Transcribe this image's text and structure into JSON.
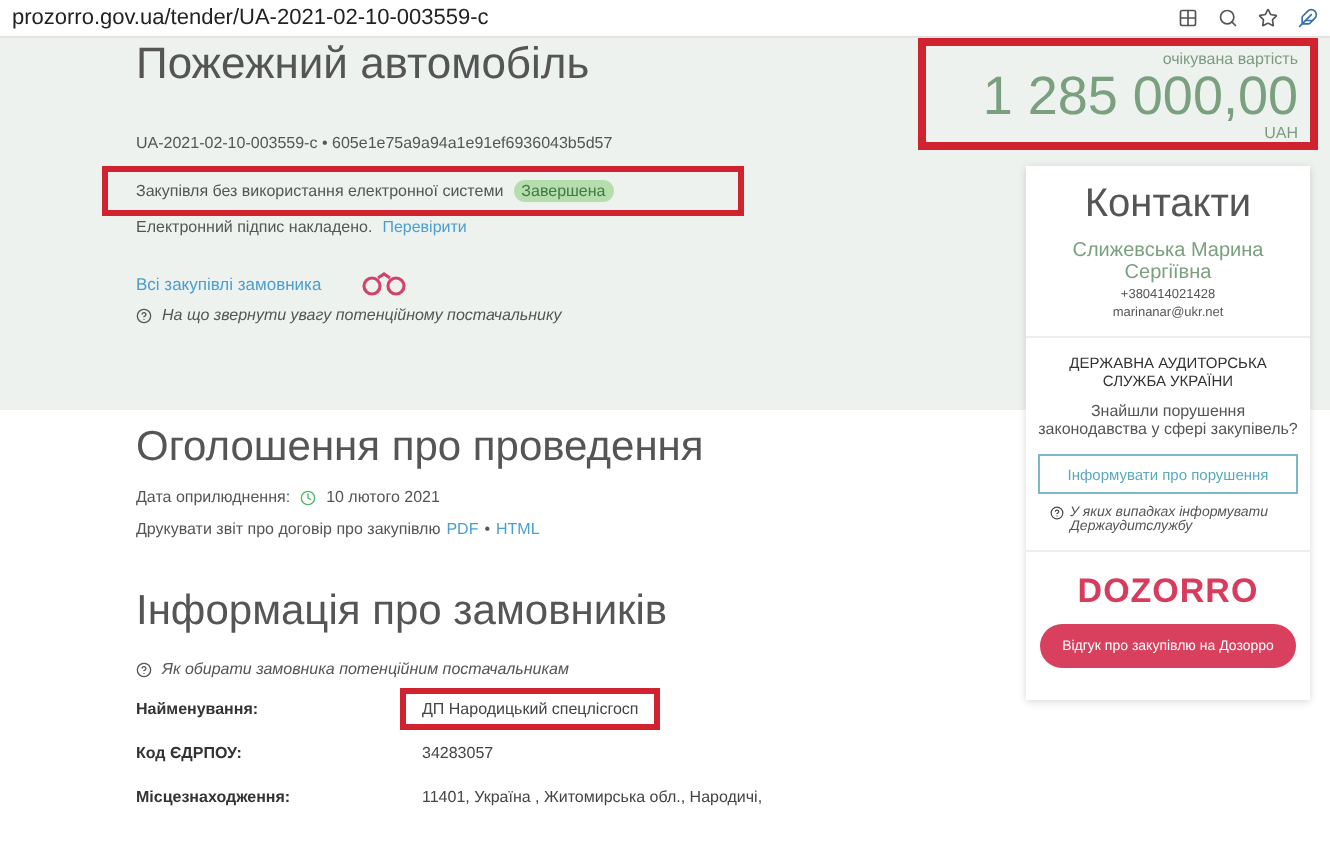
{
  "browser": {
    "url": "prozorro.gov.ua/tender/UA-2021-02-10-003559-c"
  },
  "tender": {
    "title": "Пожежний автомобіль",
    "id": "UA-2021-02-10-003559-c",
    "separator": "•",
    "hash": "605e1e75a9a94a1e91ef6936043b5d57",
    "procurement_type": "Закупівля без використання електронної системи",
    "status": "Завершена",
    "highlighted": true,
    "signature": "Електронний підпис накладено.",
    "verify_link": "Перевірити",
    "all_purchases_link": "Всі закупівлі замовника",
    "hint": "На що звернути увагу потенційному постачальнику"
  },
  "price": {
    "label": "очікувана вартість",
    "amount": "1 285 000,00",
    "currency": "UAH",
    "highlighted": true
  },
  "announcement": {
    "title": "Оголошення про проведення",
    "date_label": "Дата оприлюднення:",
    "date": "10 лютого 2021",
    "print_text": "Друкувати звіт про договір про закупівлю",
    "links": [
      "PDF",
      "HTML"
    ],
    "separator": "•"
  },
  "customer": {
    "title": "Інформація про замовників",
    "hint": "Як обирати замовника потенційним постачальникам",
    "fields": [
      {
        "label": "Найменування:",
        "value": "ДП Народицький спецлісгосп",
        "highlighted": true
      },
      {
        "label": "Код ЄДРПОУ:",
        "value": "34283057",
        "highlighted": false
      },
      {
        "label": "Місцезнаходження:",
        "value": "11401, Україна , Житомирська обл., Народичі,",
        "highlighted": false
      }
    ]
  },
  "contacts": {
    "title": "Контакти",
    "name": "Слижевська Марина Сергіївна",
    "phone": "+380414021428",
    "email": "marinanar@ukr.net"
  },
  "audit": {
    "title": "ДЕРЖАВНА АУДИТОРСЬКА СЛУЖБА УКРАЇНИ",
    "question": "Знайшли порушення законодавства у сфері закупівель?",
    "button": "Інформувати про порушення",
    "hint": "У яких випадках інформувати Держаудитслужбу"
  },
  "dozorro": {
    "logo": "DOZORRO",
    "button": "Відгук про закупівлю на Дозорро"
  }
}
